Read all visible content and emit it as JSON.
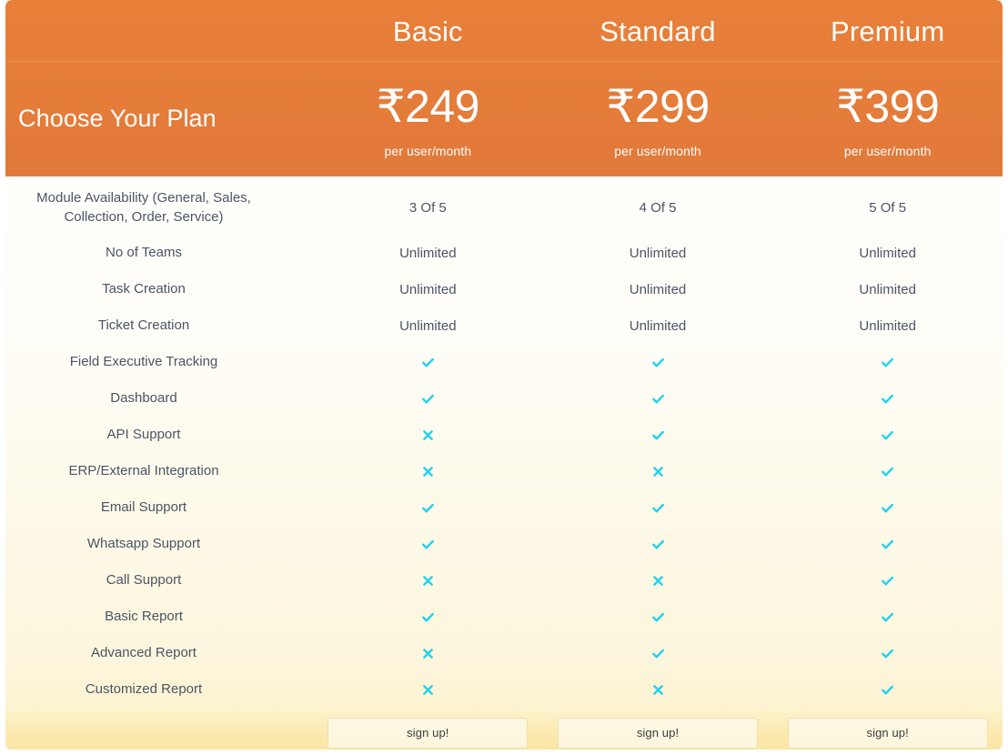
{
  "header": {
    "title": "Choose Your Plan",
    "brand_color": "#e2793a",
    "accent_color": "#22d3ee",
    "plans": [
      {
        "name": "Basic",
        "price": "₹249",
        "period": "per user/month"
      },
      {
        "name": "Standard",
        "price": "₹299",
        "period": "per user/month"
      },
      {
        "name": "Premium",
        "price": "₹399",
        "period": "per user/month"
      }
    ]
  },
  "table": {
    "rows": [
      {
        "feature": "Module Availability (General, Sales, Collection, Order, Service)",
        "tall": true,
        "values": [
          "3 Of 5",
          "4 Of 5",
          "5 Of 5"
        ],
        "types": [
          "text",
          "text",
          "text"
        ]
      },
      {
        "feature": "No of Teams",
        "tall": false,
        "values": [
          "Unlimited",
          "Unlimited",
          "Unlimited"
        ],
        "types": [
          "text",
          "text",
          "text"
        ]
      },
      {
        "feature": "Task Creation",
        "tall": false,
        "values": [
          "Unlimited",
          "Unlimited",
          "Unlimited"
        ],
        "types": [
          "text",
          "text",
          "text"
        ]
      },
      {
        "feature": "Ticket Creation",
        "tall": false,
        "values": [
          "Unlimited",
          "Unlimited",
          "Unlimited"
        ],
        "types": [
          "text",
          "text",
          "text"
        ]
      },
      {
        "feature": "Field Executive Tracking",
        "tall": false,
        "values": [
          "check",
          "check",
          "check"
        ],
        "types": [
          "icon",
          "icon",
          "icon"
        ]
      },
      {
        "feature": "Dashboard",
        "tall": false,
        "values": [
          "check",
          "check",
          "check"
        ],
        "types": [
          "icon",
          "icon",
          "icon"
        ]
      },
      {
        "feature": "API Support",
        "tall": false,
        "values": [
          "cross",
          "check",
          "check"
        ],
        "types": [
          "icon",
          "icon",
          "icon"
        ]
      },
      {
        "feature": "ERP/External Integration",
        "tall": false,
        "values": [
          "cross",
          "cross",
          "check"
        ],
        "types": [
          "icon",
          "icon",
          "icon"
        ]
      },
      {
        "feature": "Email Support",
        "tall": false,
        "values": [
          "check",
          "check",
          "check"
        ],
        "types": [
          "icon",
          "icon",
          "icon"
        ]
      },
      {
        "feature": "Whatsapp Support",
        "tall": false,
        "values": [
          "check",
          "check",
          "check"
        ],
        "types": [
          "icon",
          "icon",
          "icon"
        ]
      },
      {
        "feature": "Call Support",
        "tall": false,
        "values": [
          "cross",
          "cross",
          "check"
        ],
        "types": [
          "icon",
          "icon",
          "icon"
        ]
      },
      {
        "feature": "Basic Report",
        "tall": false,
        "values": [
          "check",
          "check",
          "check"
        ],
        "types": [
          "icon",
          "icon",
          "icon"
        ]
      },
      {
        "feature": "Advanced Report",
        "tall": false,
        "values": [
          "cross",
          "check",
          "check"
        ],
        "types": [
          "icon",
          "icon",
          "icon"
        ]
      },
      {
        "feature": "Customized Report",
        "tall": false,
        "values": [
          "cross",
          "cross",
          "check"
        ],
        "types": [
          "icon",
          "icon",
          "icon"
        ]
      }
    ]
  },
  "footer": {
    "signup_labels": [
      "sign up!",
      "sign up!",
      "sign up!"
    ]
  }
}
